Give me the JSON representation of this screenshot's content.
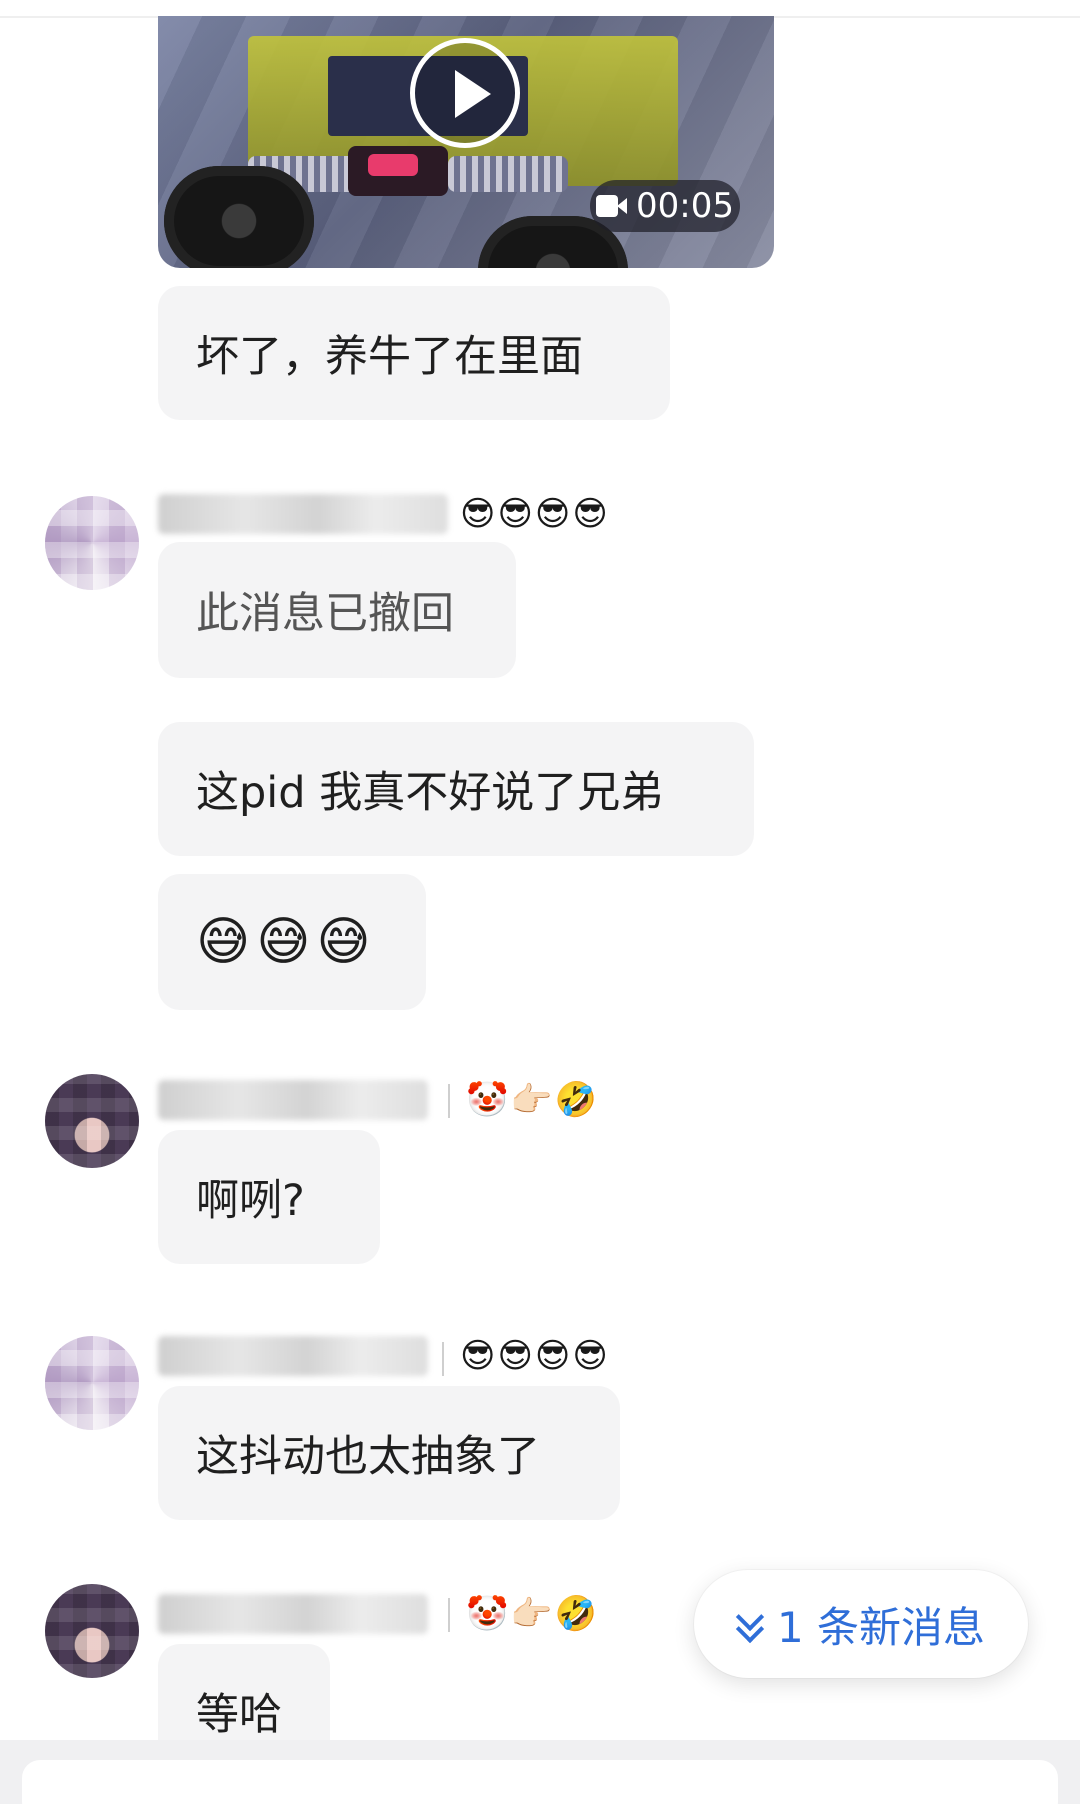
{
  "video": {
    "duration": "00:05",
    "icons": {
      "play": "play-icon",
      "camera": "video-camera-icon"
    }
  },
  "messages": [
    {
      "text": "坏了，养牛了在里面"
    },
    {
      "sender_emoji": "😎😎😎😎",
      "text": "此消息已撤回"
    },
    {
      "text": "这pid 我真不好说了兄弟"
    },
    {
      "text": "😅😅😅"
    },
    {
      "sender_emoji": "🤡👉🏻🤣",
      "text": "啊咧?"
    },
    {
      "sender_emoji": "😎😎😎😎",
      "text": "这抖动也太抽象了"
    },
    {
      "sender_emoji": "🤡👉🏻🤣",
      "text": "等哈"
    }
  ],
  "new_messages": {
    "label": "1 条新消息",
    "icon": "double-chevron-down-icon"
  },
  "colors": {
    "bubble": "#f4f4f5",
    "accent": "#2f6ed8",
    "background": "#ffffff"
  }
}
